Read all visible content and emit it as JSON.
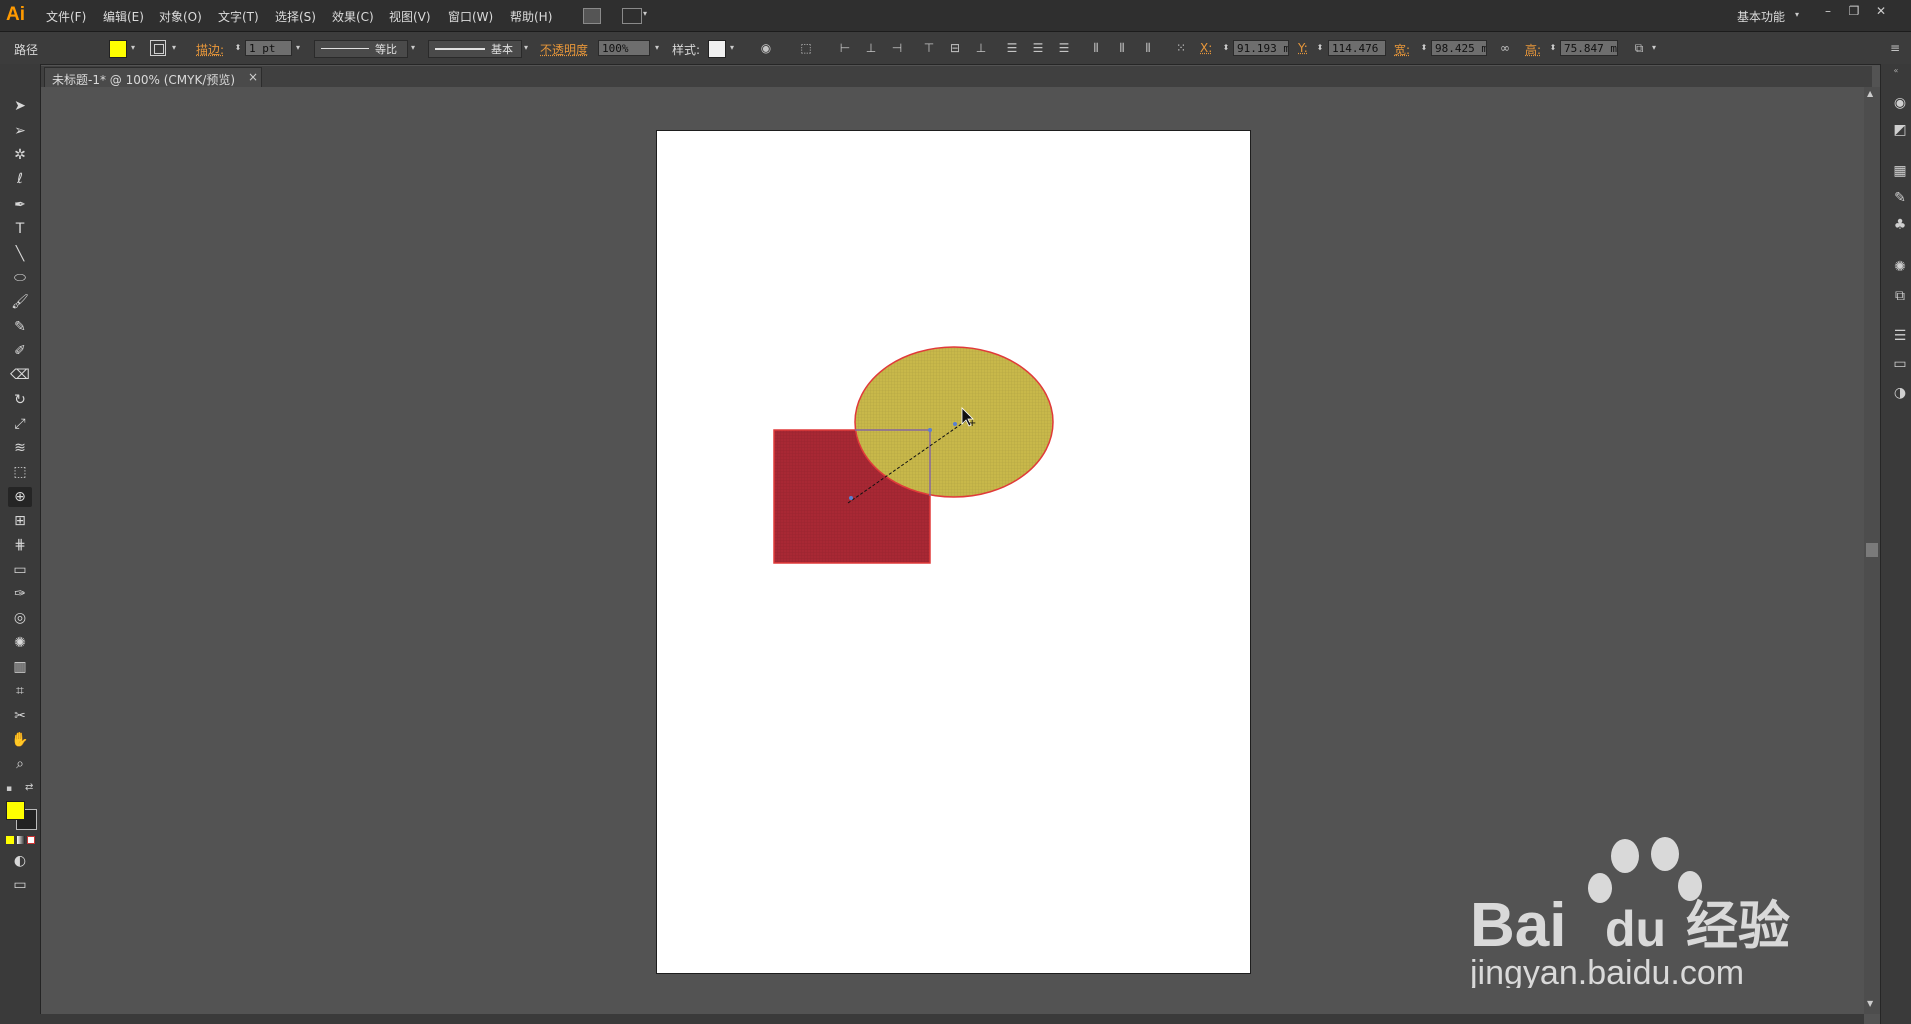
{
  "app": {
    "logo": "Ai",
    "workspace": "基本功能"
  },
  "menu": [
    "文件(F)",
    "编辑(E)",
    "对象(O)",
    "文字(T)",
    "选择(S)",
    "效果(C)",
    "视图(V)",
    "窗口(W)",
    "帮助(H)"
  ],
  "window_buttons": {
    "minimize": "–",
    "restore": "❐",
    "close": "✕"
  },
  "control_bar": {
    "object_type": "路径",
    "fill_color": "#ffff00",
    "stroke_label": "描边:",
    "stroke_weight": "1 pt",
    "stroke_profile": "等比",
    "brush": "基本",
    "opacity_label": "不透明度",
    "opacity_value": "100%",
    "style_label": "样式:",
    "x_label": "X:",
    "x_value": "91.193 m",
    "y_label": "Y:",
    "y_value": "114.476 m",
    "w_label": "宽:",
    "w_value": "98.425 m",
    "h_label": "高:",
    "h_value": "75.847 m"
  },
  "document_tab": {
    "title": "未标题-1* @ 100% (CMYK/预览)",
    "close": "×"
  },
  "canvas": {
    "rectangle_fill": "#a82834",
    "ellipse_fill": "#c8b84a",
    "selection_color": "#e03a3a"
  },
  "tools": {
    "fill_swatch": "#ffff00",
    "stroke_swatch": "#222222"
  },
  "watermark": {
    "brand": "Bai",
    "brand2": "du",
    "cn": "经验",
    "url": "jingyan.baidu.com"
  }
}
